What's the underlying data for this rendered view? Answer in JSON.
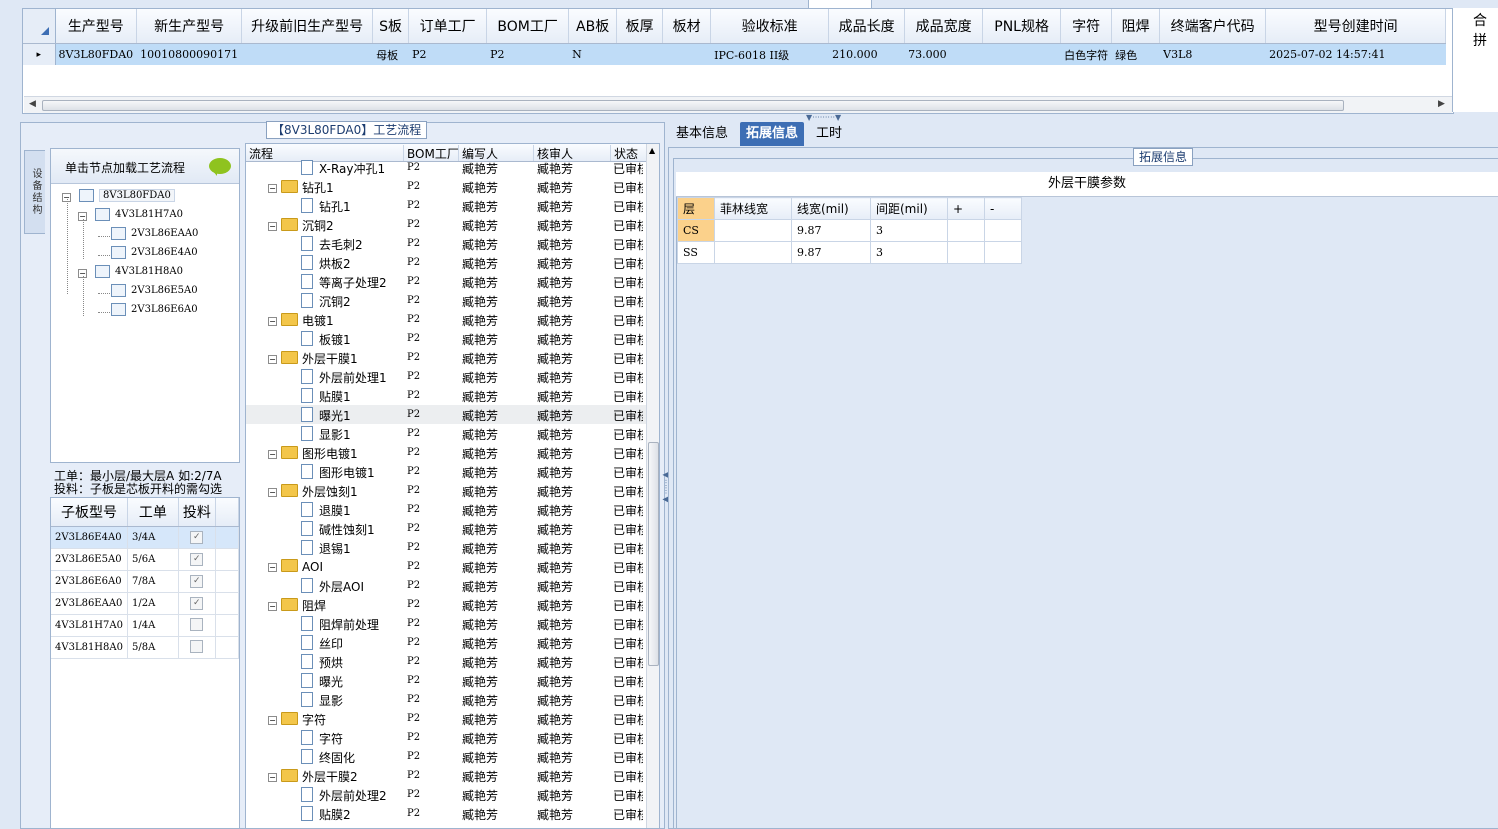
{
  "top_grid": {
    "columns": [
      "生产型号",
      "新生产型号",
      "升级前旧生产型号",
      "S板",
      "订单工厂",
      "BOM工厂",
      "AB板",
      "板厚",
      "板材",
      "验收标准",
      "成品长度",
      "成品宽度",
      "PNL规格",
      "字符",
      "阻焊",
      "终端客户代码",
      "型号创建时间"
    ],
    "row": [
      "8V3L80FDA0",
      "10010800090171",
      "",
      "母板",
      "P2",
      "P2",
      "N",
      "",
      "",
      "IPC-6018 II级",
      "210.000",
      "73.000",
      "",
      "白色字符",
      "绿色",
      "V3L8",
      "2025-07-02 14:57:41"
    ],
    "extra_header": "合拼"
  },
  "process_panel": {
    "title": "【8V3L80FDA0】工艺流程",
    "side_tab": "设备结构",
    "load_hint": "单击节点加载工艺流程",
    "tree": [
      {
        "label": "8V3L80FDA0",
        "level": 0
      },
      {
        "label": "4V3L81H7A0",
        "level": 1
      },
      {
        "label": "2V3L86EAA0",
        "level": 2
      },
      {
        "label": "2V3L86E4A0",
        "level": 2
      },
      {
        "label": "4V3L81H8A0",
        "level": 1
      },
      {
        "label": "2V3L86E5A0",
        "level": 2
      },
      {
        "label": "2V3L86E6A0",
        "level": 2
      }
    ],
    "note1": "工单：最小层/最大层A 如:2/7A",
    "note2": "投料：子板是芯板开料的需勾选",
    "sub_columns": [
      "子板型号",
      "工单",
      "投料"
    ],
    "sub_rows": [
      {
        "model": "2V3L86E4A0",
        "order": "3/4A",
        "checked": true
      },
      {
        "model": "2V3L86E5A0",
        "order": "5/6A",
        "checked": true
      },
      {
        "model": "2V3L86E6A0",
        "order": "7/8A",
        "checked": true
      },
      {
        "model": "2V3L86EAA0",
        "order": "1/2A",
        "checked": true
      },
      {
        "model": "4V3L81H7A0",
        "order": "1/4A",
        "checked": false
      },
      {
        "model": "4V3L81H8A0",
        "order": "5/8A",
        "checked": false
      }
    ],
    "proc_columns": [
      "流程",
      "BOM工厂",
      "编写人",
      "核审人",
      "状态"
    ],
    "proc_rows": [
      {
        "name": "X-Ray冲孔1",
        "type": "doc",
        "bom": "P2",
        "writer": "臧艳芳",
        "reviewer": "臧艳芳",
        "status": "已审核"
      },
      {
        "name": "钻孔1",
        "type": "folder",
        "bom": "P2",
        "writer": "臧艳芳",
        "reviewer": "臧艳芳",
        "status": "已审核"
      },
      {
        "name": "钻孔1",
        "type": "doc",
        "bom": "P2",
        "writer": "臧艳芳",
        "reviewer": "臧艳芳",
        "status": "已审核"
      },
      {
        "name": "沉铜2",
        "type": "folder",
        "bom": "P2",
        "writer": "臧艳芳",
        "reviewer": "臧艳芳",
        "status": "已审核"
      },
      {
        "name": "去毛刺2",
        "type": "doc",
        "bom": "P2",
        "writer": "臧艳芳",
        "reviewer": "臧艳芳",
        "status": "已审核"
      },
      {
        "name": "烘板2",
        "type": "doc",
        "bom": "P2",
        "writer": "臧艳芳",
        "reviewer": "臧艳芳",
        "status": "已审核"
      },
      {
        "name": "等离子处理2",
        "type": "doc",
        "bom": "P2",
        "writer": "臧艳芳",
        "reviewer": "臧艳芳",
        "status": "已审核"
      },
      {
        "name": "沉铜2",
        "type": "doc",
        "bom": "P2",
        "writer": "臧艳芳",
        "reviewer": "臧艳芳",
        "status": "已审核"
      },
      {
        "name": "电镀1",
        "type": "folder",
        "bom": "P2",
        "writer": "臧艳芳",
        "reviewer": "臧艳芳",
        "status": "已审核"
      },
      {
        "name": "板镀1",
        "type": "doc",
        "bom": "P2",
        "writer": "臧艳芳",
        "reviewer": "臧艳芳",
        "status": "已审核"
      },
      {
        "name": "外层干膜1",
        "type": "folder",
        "bom": "P2",
        "writer": "臧艳芳",
        "reviewer": "臧艳芳",
        "status": "已审核"
      },
      {
        "name": "外层前处理1",
        "type": "doc",
        "bom": "P2",
        "writer": "臧艳芳",
        "reviewer": "臧艳芳",
        "status": "已审核"
      },
      {
        "name": "贴膜1",
        "type": "doc",
        "bom": "P2",
        "writer": "臧艳芳",
        "reviewer": "臧艳芳",
        "status": "已审核"
      },
      {
        "name": "曝光1",
        "type": "doc",
        "bom": "P2",
        "writer": "臧艳芳",
        "reviewer": "臧艳芳",
        "status": "已审核",
        "selected": true
      },
      {
        "name": "显影1",
        "type": "doc",
        "bom": "P2",
        "writer": "臧艳芳",
        "reviewer": "臧艳芳",
        "status": "已审核"
      },
      {
        "name": "图形电镀1",
        "type": "folder",
        "bom": "P2",
        "writer": "臧艳芳",
        "reviewer": "臧艳芳",
        "status": "已审核"
      },
      {
        "name": "图形电镀1",
        "type": "doc",
        "bom": "P2",
        "writer": "臧艳芳",
        "reviewer": "臧艳芳",
        "status": "已审核"
      },
      {
        "name": "外层蚀刻1",
        "type": "folder",
        "bom": "P2",
        "writer": "臧艳芳",
        "reviewer": "臧艳芳",
        "status": "已审核"
      },
      {
        "name": "退膜1",
        "type": "doc",
        "bom": "P2",
        "writer": "臧艳芳",
        "reviewer": "臧艳芳",
        "status": "已审核"
      },
      {
        "name": "碱性蚀刻1",
        "type": "doc",
        "bom": "P2",
        "writer": "臧艳芳",
        "reviewer": "臧艳芳",
        "status": "已审核"
      },
      {
        "name": "退锡1",
        "type": "doc",
        "bom": "P2",
        "writer": "臧艳芳",
        "reviewer": "臧艳芳",
        "status": "已审核"
      },
      {
        "name": "AOI",
        "type": "folder",
        "bom": "P2",
        "writer": "臧艳芳",
        "reviewer": "臧艳芳",
        "status": "已审核"
      },
      {
        "name": "外层AOI",
        "type": "doc",
        "bom": "P2",
        "writer": "臧艳芳",
        "reviewer": "臧艳芳",
        "status": "已审核"
      },
      {
        "name": "阻焊",
        "type": "folder",
        "bom": "P2",
        "writer": "臧艳芳",
        "reviewer": "臧艳芳",
        "status": "已审核"
      },
      {
        "name": "阻焊前处理",
        "type": "doc",
        "bom": "P2",
        "writer": "臧艳芳",
        "reviewer": "臧艳芳",
        "status": "已审核"
      },
      {
        "name": "丝印",
        "type": "doc",
        "bom": "P2",
        "writer": "臧艳芳",
        "reviewer": "臧艳芳",
        "status": "已审核"
      },
      {
        "name": "预烘",
        "type": "doc",
        "bom": "P2",
        "writer": "臧艳芳",
        "reviewer": "臧艳芳",
        "status": "已审核"
      },
      {
        "name": "曝光",
        "type": "doc",
        "bom": "P2",
        "writer": "臧艳芳",
        "reviewer": "臧艳芳",
        "status": "已审核"
      },
      {
        "name": "显影",
        "type": "doc",
        "bom": "P2",
        "writer": "臧艳芳",
        "reviewer": "臧艳芳",
        "status": "已审核"
      },
      {
        "name": "字符",
        "type": "folder",
        "bom": "P2",
        "writer": "臧艳芳",
        "reviewer": "臧艳芳",
        "status": "已审核"
      },
      {
        "name": "字符",
        "type": "doc",
        "bom": "P2",
        "writer": "臧艳芳",
        "reviewer": "臧艳芳",
        "status": "已审核"
      },
      {
        "name": "终固化",
        "type": "doc",
        "bom": "P2",
        "writer": "臧艳芳",
        "reviewer": "臧艳芳",
        "status": "已审核"
      },
      {
        "name": "外层干膜2",
        "type": "folder",
        "bom": "P2",
        "writer": "臧艳芳",
        "reviewer": "臧艳芳",
        "status": "已审核"
      },
      {
        "name": "外层前处理2",
        "type": "doc",
        "bom": "P2",
        "writer": "臧艳芳",
        "reviewer": "臧艳芳",
        "status": "已审核"
      },
      {
        "name": "贴膜2",
        "type": "doc",
        "bom": "P2",
        "writer": "臧艳芳",
        "reviewer": "臧艳芳",
        "status": "已审核"
      }
    ]
  },
  "right_panel": {
    "tabs": [
      "基本信息",
      "拓展信息",
      "工时"
    ],
    "active_tab": 1,
    "group_title": "拓展信息",
    "param_title": "外层干膜参数",
    "param_columns": [
      "层",
      "菲林线宽",
      "线宽(mil)",
      "间距(mil)",
      "+",
      "-"
    ],
    "param_rows": [
      [
        "CS",
        "",
        "9.87",
        "3",
        "",
        ""
      ],
      [
        "SS",
        "",
        "9.87",
        "3",
        "",
        ""
      ]
    ]
  },
  "colors": {
    "selection": "#bfdcf7",
    "accent_tab": "#3d6eb4",
    "highlight_cell": "#fbd18b",
    "folder": "#f3c64a"
  }
}
